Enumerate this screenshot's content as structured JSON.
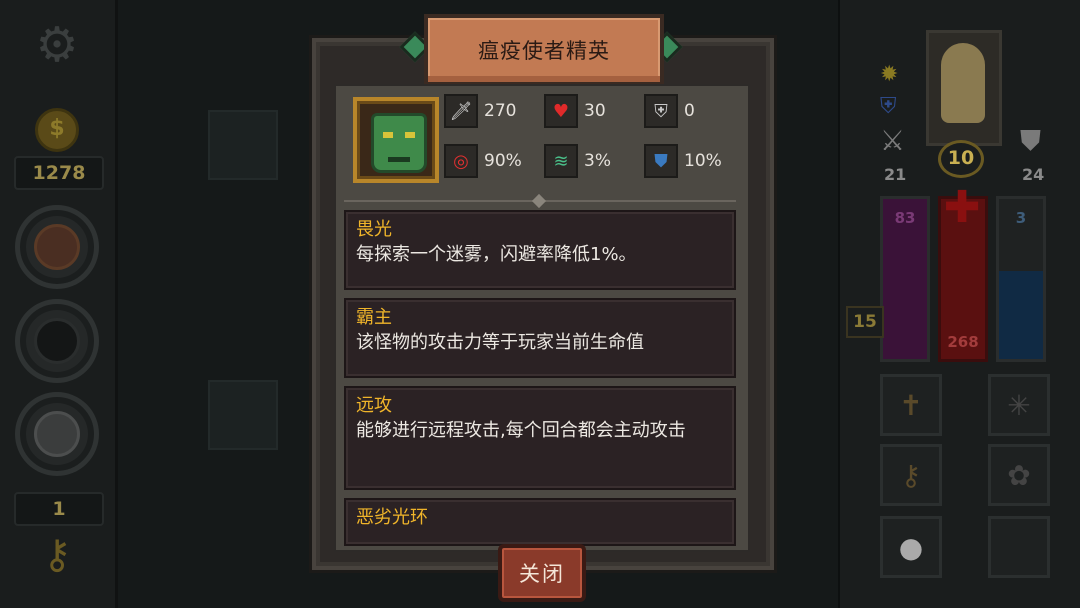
{
  "hud": {
    "gold": "1278",
    "keys": "1",
    "behind_monster_attack": "270",
    "right": {
      "attack": "21",
      "defense": "24",
      "level": "10",
      "mana": "83",
      "hp": "268",
      "shield": "3",
      "floor": "15"
    }
  },
  "dialog": {
    "title": "瘟疫使者精英",
    "stats": {
      "attack": "270",
      "hp": "30",
      "defense": "0",
      "hit": "90%",
      "dodge": "3%",
      "resist": "10%"
    },
    "skills": [
      {
        "name": "畏光",
        "desc": "每探索一个迷雾，闪避率降低1%。"
      },
      {
        "name": "霸主",
        "desc": "该怪物的攻击力等于玩家当前生命值"
      },
      {
        "name": "远攻",
        "desc": "能够进行远程攻击,每个回合都会主动攻击"
      },
      {
        "name": "恶劣光环",
        "desc": ""
      }
    ],
    "close_label": "关闭"
  },
  "colors": {
    "skill_name": "#f0b52a",
    "banner": "#c27a53",
    "panel": "#4c4943",
    "skill_bg": "#2b2224"
  },
  "icons": {
    "attack": "sword-icon",
    "hp": "heart-icon",
    "defense": "shield-icon",
    "hit": "target-icon",
    "dodge": "tornado-icon",
    "resist": "resist-shield-icon"
  }
}
